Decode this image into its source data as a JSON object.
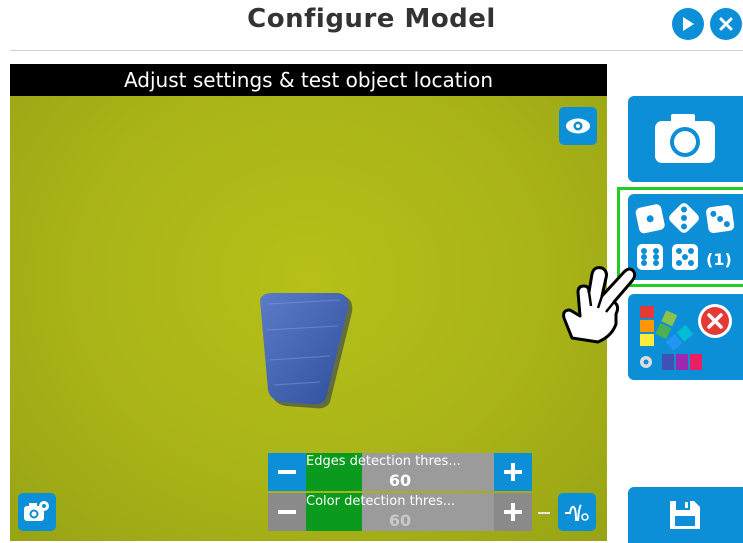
{
  "header": {
    "title": "Configure Model"
  },
  "camera": {
    "caption": "Adjust settings & test object location"
  },
  "sliders": [
    {
      "label": "Edges detection thres...",
      "value": "60",
      "level": 0.3
    },
    {
      "label": "Color detection thres...",
      "value": "60",
      "level": 0.3
    }
  ],
  "sidebar": {
    "model_count": "(1)"
  },
  "colors": {
    "accent": "#0c8fd6",
    "green": "#0a9a1e",
    "highlight": "#22cc22"
  }
}
